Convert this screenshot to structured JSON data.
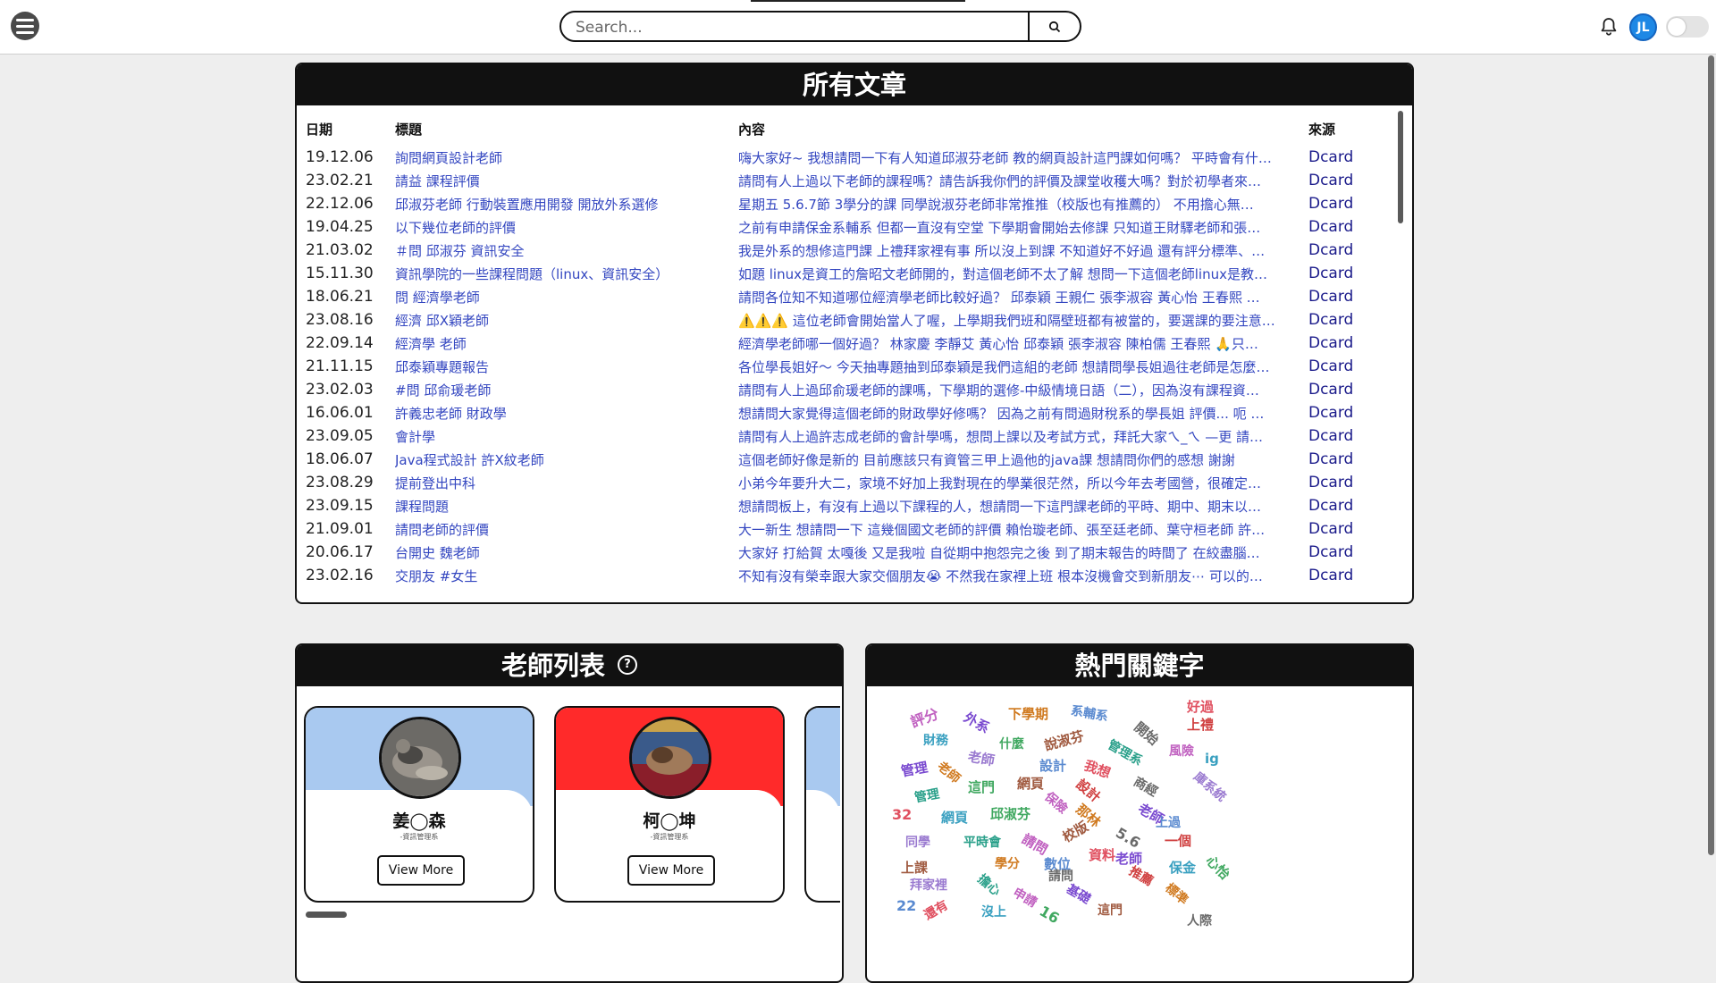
{
  "search": {
    "placeholder": "Search..."
  },
  "user": {
    "initials": "JL"
  },
  "articles": {
    "title": "所有文章",
    "headers": {
      "date": "日期",
      "title": "標題",
      "content": "內容",
      "source": "來源"
    },
    "rows": [
      {
        "date": "19.12.06",
        "title": "詢問網頁設計老師",
        "content": "嗨大家好~ 我想請問一下有人知道邱淑芬老師 教的網頁設計這門課如何嗎？ 平時會有什…",
        "source": "Dcard"
      },
      {
        "date": "23.02.21",
        "title": "請益 課程評價",
        "content": "請問有人上過以下老師的課程嗎？請告訴我你們的評價及課堂收穫大嗎？對於初學者來…",
        "source": "Dcard"
      },
      {
        "date": "22.12.06",
        "title": "邱淑芬老師 行動裝置應用開發 開放外系選修",
        "content": "星期五 5.6.7節 3學分的課 同學說淑芬老師非常推推（校版也有推薦的） 不用擔心無…",
        "source": "Dcard"
      },
      {
        "date": "19.04.25",
        "title": "以下幾位老師的評價",
        "content": "之前有申請保金系輔系 但都一直沒有空堂 下學期會開始去修課 只知道王財驛老師和張…",
        "source": "Dcard"
      },
      {
        "date": "21.03.02",
        "title": "＃問 邱淑芬 資訊安全",
        "content": "我是外系的想修這門課 上禮拜家裡有事 所以沒上到課 不知道好不好過 還有評分標準、…",
        "source": "Dcard"
      },
      {
        "date": "15.11.30",
        "title": "資訊學院的一些課程問題（linux、資訊安全）",
        "content": "如題 linux是資工的詹昭文老師開的，對這個老師不太了解 想問一下這個老師linux是教…",
        "source": "Dcard"
      },
      {
        "date": "18.06.21",
        "title": "問 經濟學老師",
        "content": "請問各位知不知道哪位經濟學老師比較好過？ 邱泰穎 王親仁 張李淑容 黃心怡 王春熙 …",
        "source": "Dcard"
      },
      {
        "date": "23.08.16",
        "title": "經濟 邱X穎老師",
        "content": "⚠️⚠️⚠️ 這位老師會開始當人了喔，上學期我們班和隔壁班都有被當的，要選課的要注意…",
        "source": "Dcard"
      },
      {
        "date": "22.09.14",
        "title": "經濟學 老師",
        "content": "經濟學老師哪一個好過？ 林家慶 李靜艾 黃心怡 邱泰穎 張李淑容 陳柏儒 王春熙 🙏只…",
        "source": "Dcard"
      },
      {
        "date": "21.11.15",
        "title": "邱泰穎專題報告",
        "content": "各位學長姐好～ 今天抽專題抽到邱泰穎是我們這組的老師 想請問學長姐過往老師是怎麼…",
        "source": "Dcard"
      },
      {
        "date": "23.02.03",
        "title": "#問 邱俞瑗老師",
        "content": "請問有人上過邱俞瑗老師的課嗎，下學期的選修-中級情境日語（二），因為沒有課程資…",
        "source": "Dcard"
      },
      {
        "date": "16.06.01",
        "title": "許義忠老師 財政學",
        "content": "想請問大家覺得這個老師的財政學好修嗎？ 因為之前有問過財稅系的學長姐 評價... 呃 …",
        "source": "Dcard"
      },
      {
        "date": "23.09.05",
        "title": "會計學",
        "content": "請問有人上過許志成老師的會計學嗎，想問上課以及考試方式，拜託大家ㄟ_ㄟ —更 請…",
        "source": "Dcard"
      },
      {
        "date": "18.06.07",
        "title": "Java程式設計 許X紋老師",
        "content": "這個老師好像是新的 目前應該只有資管三甲上過他的java課 想請問你們的感想 謝謝",
        "source": "Dcard"
      },
      {
        "date": "23.08.29",
        "title": "提前登出中科",
        "content": "小弟今年要升大二，家境不好加上我對現在的學業很茫然，所以今年去考國營，很確定…",
        "source": "Dcard"
      },
      {
        "date": "23.09.15",
        "title": "課程問題",
        "content": "想請問板上，有沒有上過以下課程的人，想請問一下這門課老師的平時、期中、期末以…",
        "source": "Dcard"
      },
      {
        "date": "21.09.01",
        "title": "請問老師的評價",
        "content": "大一新生 想請問一下 這幾個國文老師的評價 賴怡璇老師、張至廷老師、葉守桓老師 許…",
        "source": "Dcard"
      },
      {
        "date": "20.06.17",
        "title": "台開史 魏老師",
        "content": "大家好 打給賀 太嘎後 又是我啦 自從期中抱怨完之後 到了期末報告的時間了 在絞盡腦…",
        "source": "Dcard"
      },
      {
        "date": "23.02.16",
        "title": "交朋友 #女生",
        "content": "不知有沒有榮幸跟大家交個朋友😭 不然我在家裡上班 根本沒機會交到新朋友⋯ 可以的…",
        "source": "Dcard"
      }
    ]
  },
  "teachers": {
    "title": "老師列表",
    "help_icon": "question-circle-icon",
    "cards": [
      {
        "name": "姜◯森",
        "dept": "-資訊管理系",
        "button": "View More",
        "color": "#a9c9f0"
      },
      {
        "name": "柯◯坤",
        "dept": "-資訊管理系",
        "button": "View More",
        "color": "#ff2a2a"
      }
    ]
  },
  "keywords": {
    "title": "熱門關鍵字",
    "words": [
      "評分",
      "外系",
      "下學期",
      "系輔系",
      "好過",
      "財務",
      "什麼",
      "說淑芬",
      "開始",
      "上禮",
      "老師",
      "管理系",
      "風險",
      "管理",
      "老師",
      "設計",
      "我想",
      "ig",
      "這門",
      "網頁",
      "商經",
      "設計",
      "庫系統",
      "管理",
      "保險",
      "老師",
      "那林",
      "上過",
      "32",
      "網頁",
      "邱淑芬",
      "校版",
      "5.6",
      "一個",
      "同學",
      "平時會",
      "請問",
      "老師",
      "學分",
      "數位",
      "資料",
      "保金",
      "心怡",
      "上課",
      "請問",
      "推薦",
      "拜家裡",
      "擔心",
      "申請",
      "基礎",
      "標準",
      "22",
      "還有",
      "沒上",
      "16",
      "這門",
      "人際"
    ]
  }
}
